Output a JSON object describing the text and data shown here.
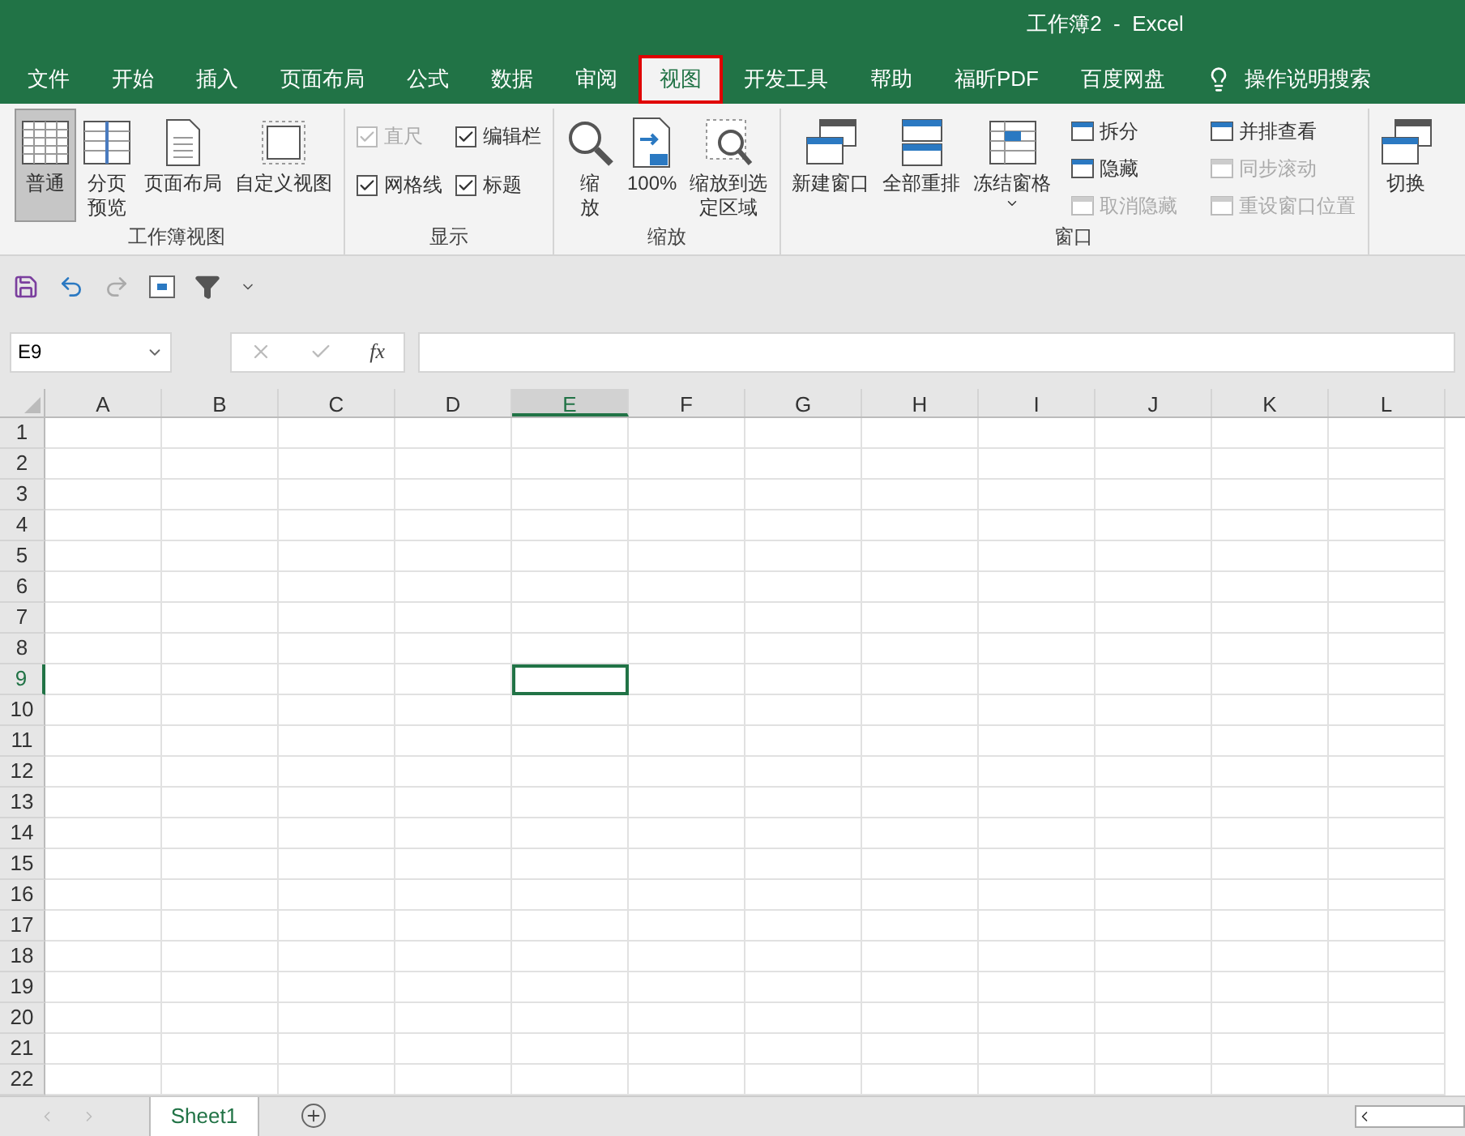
{
  "window": {
    "title": "工作簿2  -  Excel"
  },
  "tabs": [
    {
      "label": "文件",
      "selected": false
    },
    {
      "label": "开始",
      "selected": false
    },
    {
      "label": "插入",
      "selected": false
    },
    {
      "label": "页面布局",
      "selected": false
    },
    {
      "label": "公式",
      "selected": false
    },
    {
      "label": "数据",
      "selected": false
    },
    {
      "label": "审阅",
      "selected": false
    },
    {
      "label": "视图",
      "selected": true
    },
    {
      "label": "开发工具",
      "selected": false
    },
    {
      "label": "帮助",
      "selected": false
    },
    {
      "label": "福昕PDF",
      "selected": false
    },
    {
      "label": "百度网盘",
      "selected": false
    }
  ],
  "tell_me": {
    "placeholder": "操作说明搜索"
  },
  "ribbon_groups": [
    {
      "label": "工作簿视图",
      "items": [
        {
          "kind": "large",
          "label": "普通",
          "selected": true
        },
        {
          "kind": "large",
          "label": "分页预览",
          "selected": false
        },
        {
          "kind": "large",
          "label": "页面布局",
          "selected": false
        },
        {
          "kind": "large",
          "label": "自定义视图",
          "selected": false
        }
      ]
    },
    {
      "label": "显示",
      "items": [
        {
          "kind": "check",
          "label": "直尺",
          "checked": true,
          "disabled": true
        },
        {
          "kind": "check",
          "label": "编辑栏",
          "checked": true,
          "disabled": false
        },
        {
          "kind": "check",
          "label": "网格线",
          "checked": true,
          "disabled": false
        },
        {
          "kind": "check",
          "label": "标题",
          "checked": true,
          "disabled": false
        }
      ]
    },
    {
      "label": "缩放",
      "items": [
        {
          "kind": "large",
          "label": "缩放",
          "selected": false
        },
        {
          "kind": "large",
          "label": "100%",
          "selected": false
        },
        {
          "kind": "large",
          "label": "缩放到选定区域",
          "selected": false
        }
      ]
    },
    {
      "label": "窗口",
      "items": [
        {
          "kind": "large",
          "label": "新建窗口",
          "selected": false
        },
        {
          "kind": "large",
          "label": "全部重排",
          "selected": false
        },
        {
          "kind": "large",
          "label": "冻结窗格",
          "selected": false
        },
        {
          "kind": "small",
          "label": "拆分",
          "disabled": false
        },
        {
          "kind": "small",
          "label": "隐藏",
          "disabled": false
        },
        {
          "kind": "small",
          "label": "取消隐藏",
          "disabled": true
        },
        {
          "kind": "small",
          "label": "并排查看",
          "disabled": false
        },
        {
          "kind": "small",
          "label": "同步滚动",
          "disabled": true
        },
        {
          "kind": "small",
          "label": "重设窗口位置",
          "disabled": true
        }
      ]
    },
    {
      "items": [
        {
          "kind": "large",
          "label": "切换",
          "selected": false
        }
      ]
    }
  ],
  "formula_bar": {
    "name_box": "E9",
    "fx": "fx"
  },
  "grid": {
    "columns": [
      {
        "label": "A",
        "selected": false
      },
      {
        "label": "B",
        "selected": false
      },
      {
        "label": "C",
        "selected": false
      },
      {
        "label": "D",
        "selected": false
      },
      {
        "label": "E",
        "selected": true
      },
      {
        "label": "F",
        "selected": false
      },
      {
        "label": "G",
        "selected": false
      },
      {
        "label": "H",
        "selected": false
      },
      {
        "label": "I",
        "selected": false
      },
      {
        "label": "J",
        "selected": false
      },
      {
        "label": "K",
        "selected": false
      },
      {
        "label": "L",
        "selected": false
      }
    ],
    "rows": [
      {
        "label": "1",
        "selected": false
      },
      {
        "label": "2",
        "selected": false
      },
      {
        "label": "3",
        "selected": false
      },
      {
        "label": "4",
        "selected": false
      },
      {
        "label": "5",
        "selected": false
      },
      {
        "label": "6",
        "selected": false
      },
      {
        "label": "7",
        "selected": false
      },
      {
        "label": "8",
        "selected": false
      },
      {
        "label": "9",
        "selected": true
      },
      {
        "label": "10",
        "selected": false
      },
      {
        "label": "11",
        "selected": false
      },
      {
        "label": "12",
        "selected": false
      },
      {
        "label": "13",
        "selected": false
      },
      {
        "label": "14",
        "selected": false
      },
      {
        "label": "15",
        "selected": false
      },
      {
        "label": "16",
        "selected": false
      },
      {
        "label": "17",
        "selected": false
      },
      {
        "label": "18",
        "selected": false
      },
      {
        "label": "19",
        "selected": false
      },
      {
        "label": "20",
        "selected": false
      },
      {
        "label": "21",
        "selected": false
      },
      {
        "label": "22",
        "selected": false
      }
    ]
  },
  "sheets": [
    {
      "label": "Sheet1",
      "selected": true
    }
  ]
}
